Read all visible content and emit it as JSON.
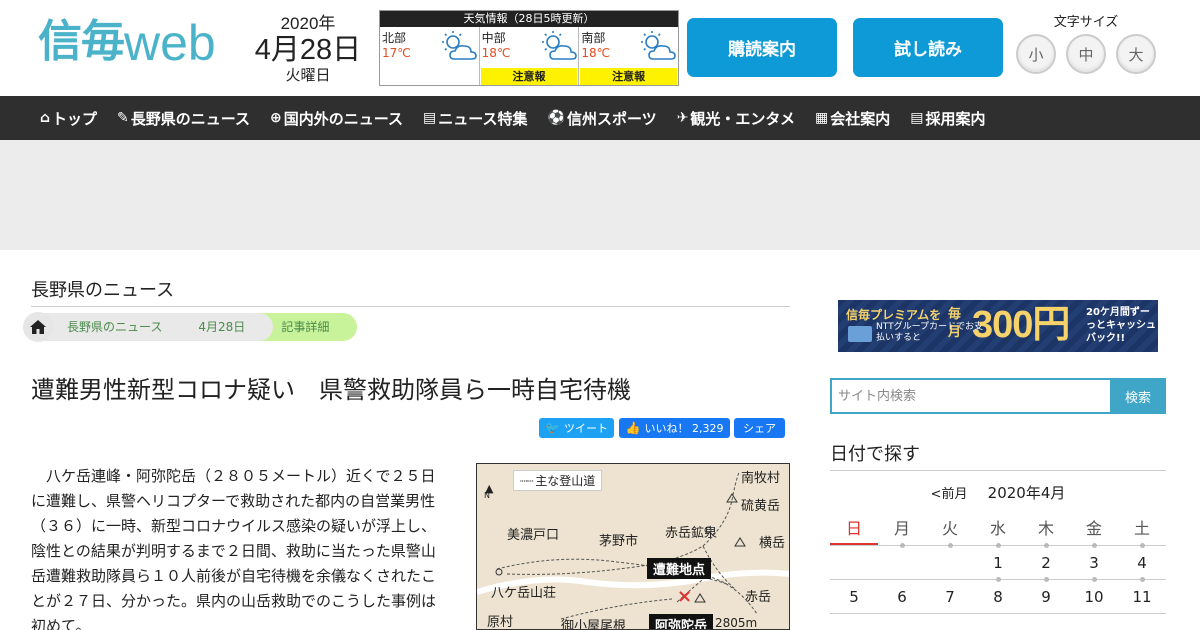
{
  "header": {
    "logo_kanji": "信毎",
    "logo_web": "web",
    "date_year": "2020年",
    "date_md": "4月28日",
    "date_dow": "火曜日",
    "weather": {
      "title": "天気情報（28日5時更新）",
      "regions": [
        {
          "name": "北部",
          "temp": "17℃",
          "warning": ""
        },
        {
          "name": "中部",
          "temp": "18℃",
          "warning": "注意報"
        },
        {
          "name": "南部",
          "temp": "18℃",
          "warning": "注意報"
        }
      ]
    },
    "subscribe_label": "購読案内",
    "trial_label": "試し読み",
    "fontsize_label": "文字サイズ",
    "fontsize_small": "小",
    "fontsize_medium": "中",
    "fontsize_large": "大"
  },
  "nav": {
    "items": [
      {
        "label": "トップ",
        "icon": "⌂"
      },
      {
        "label": "長野県のニュース",
        "icon": "✎"
      },
      {
        "label": "国内外のニュース",
        "icon": "⊕"
      },
      {
        "label": "ニュース特集",
        "icon": "▤"
      },
      {
        "label": "信州スポーツ",
        "icon": "⚽"
      },
      {
        "label": "観光・エンタメ",
        "icon": "✈"
      },
      {
        "label": "会社案内",
        "icon": "▦"
      },
      {
        "label": "採用案内",
        "icon": "▤"
      }
    ]
  },
  "main": {
    "section_title": "長野県のニュース",
    "breadcrumbs": [
      "長野県のニュース",
      "4月28日",
      "記事詳細"
    ],
    "headline": "遭難男性新型コロナ疑い　県警救助隊員ら一時自宅待機",
    "share": {
      "tweet": "ツイート",
      "like": "いいね！ 2,329",
      "share": "シェア"
    },
    "body": "八ケ岳連峰・阿弥陀岳（２８０５メートル）近くで２５日に遭難し、県警ヘリコプターで救助された都内の自営業男性（３６）に一時、新型コロナウイルス感染の疑いが浮上し、陰性との結果が判明するまで２日間、救助に当たった県警山岳遭難救助隊員ら１０人前後が自宅待機を余儀なくされたことが２７日、分かった。県内の山岳救助でのこうした事例は初めて。",
    "map": {
      "legend": "主な登山道",
      "labels": [
        {
          "id": "minamimaki",
          "text": "南牧村"
        },
        {
          "id": "iodake",
          "text": "硫黄岳"
        },
        {
          "id": "minoto",
          "text": "美濃戸口"
        },
        {
          "id": "chino",
          "text": "茅野市"
        },
        {
          "id": "akadake-kosen",
          "text": "赤岳鉱泉"
        },
        {
          "id": "yokodake",
          "text": "横岳"
        },
        {
          "id": "yatsugatake-sanso",
          "text": "八ケ岳山荘"
        },
        {
          "id": "akadake",
          "text": "赤岳"
        },
        {
          "id": "hara",
          "text": "原村"
        },
        {
          "id": "okoya",
          "text": "御小屋尾根"
        },
        {
          "id": "elev",
          "text": "2805m"
        }
      ],
      "tag_accident": "遭難地点",
      "tag_amida": "阿弥陀岳"
    }
  },
  "sidebar": {
    "premium": {
      "line1": "信毎プレミアムを",
      "line2": "NTTグループカードでお支払いすると",
      "small": "毎月",
      "big": "300円",
      "right": "20ケ月間ずーっとキャッシュバック!!"
    },
    "search_placeholder": "サイト内検索",
    "search_button": "検索",
    "calendar_title": "日付で探す",
    "cal_prev": "<前月",
    "cal_month": "2020年4月",
    "weekdays": [
      "日",
      "月",
      "火",
      "水",
      "木",
      "金",
      "土"
    ],
    "weeks": [
      [
        "",
        "",
        "",
        "1",
        "2",
        "3",
        "4"
      ],
      [
        "5",
        "6",
        "7",
        "8",
        "9",
        "10",
        "11"
      ]
    ]
  },
  "colors": {
    "brand": "#4bb3c9",
    "button_blue": "#0e9ad6",
    "nav_bg": "#2f2f2f",
    "warning_yellow": "#fff200",
    "sunday_red": "#d33"
  }
}
